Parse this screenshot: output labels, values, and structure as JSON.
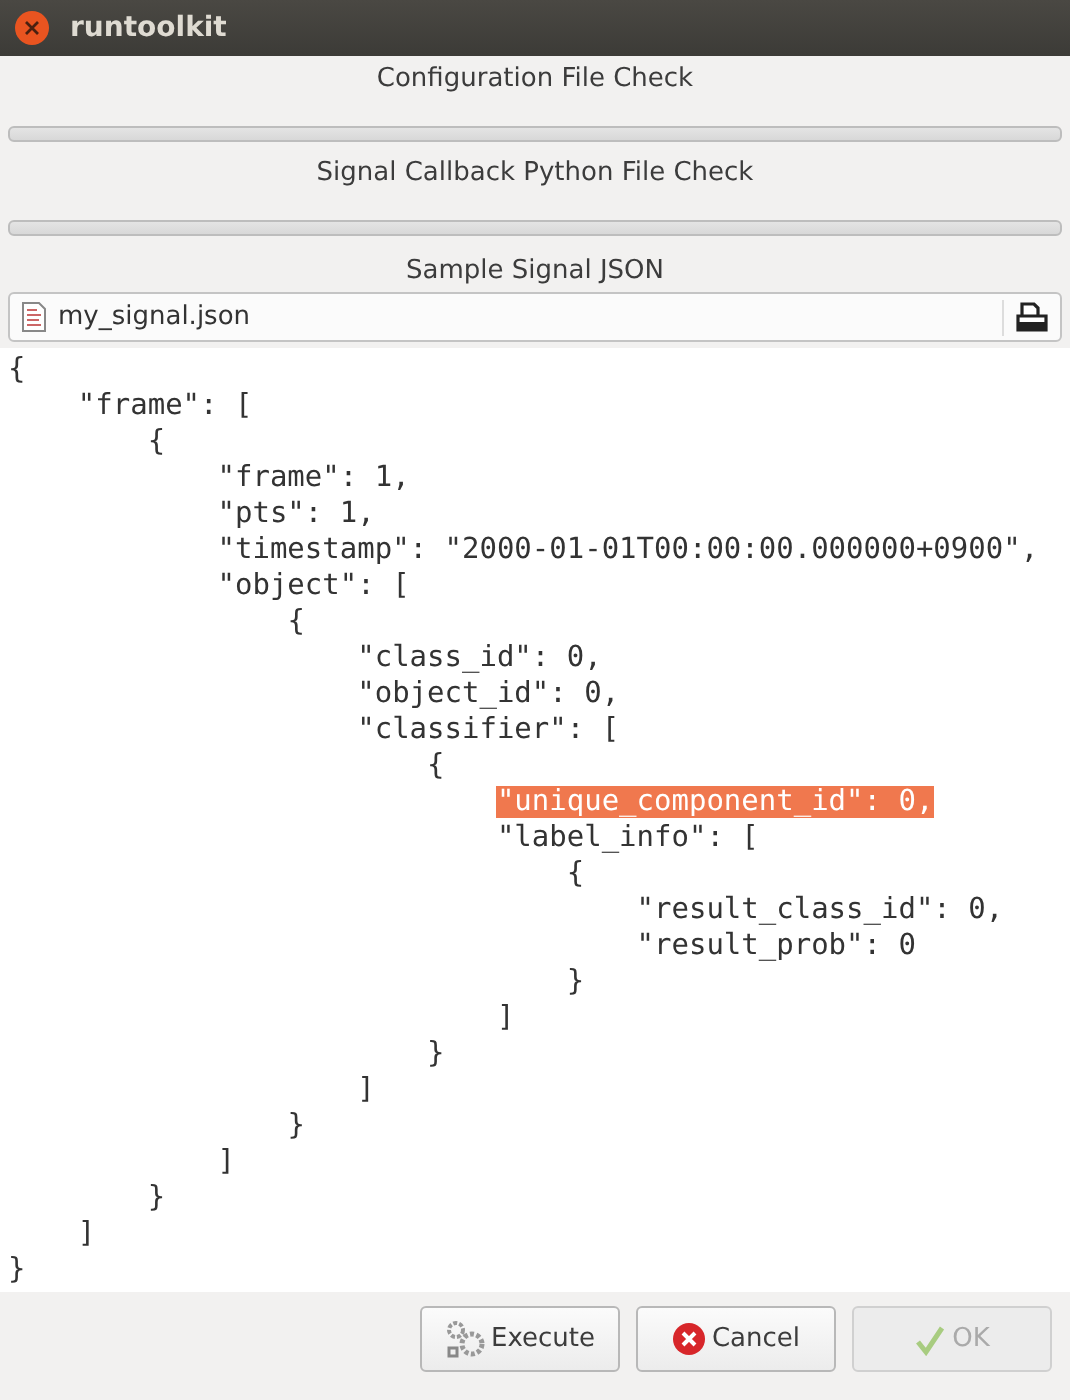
{
  "window": {
    "title": "runtoolkit"
  },
  "checks": [
    {
      "label": "Configuration File Check"
    },
    {
      "label": "Signal Callback Python File Check"
    }
  ],
  "sample": {
    "label": "Sample Signal JSON",
    "file": "my_signal.json"
  },
  "code_lines": [
    {
      "text": "{",
      "highlighted": false
    },
    {
      "text": "    \"frame\": [",
      "highlighted": false
    },
    {
      "text": "        {",
      "highlighted": false
    },
    {
      "text": "            \"frame\": 1,",
      "highlighted": false
    },
    {
      "text": "            \"pts\": 1,",
      "highlighted": false
    },
    {
      "text": "            \"timestamp\": \"2000-01-01T00:00:00.000000+0900\",",
      "highlighted": false
    },
    {
      "text": "            \"object\": [",
      "highlighted": false
    },
    {
      "text": "                {",
      "highlighted": false
    },
    {
      "text": "                    \"class_id\": 0,",
      "highlighted": false
    },
    {
      "text": "                    \"object_id\": 0,",
      "highlighted": false
    },
    {
      "text": "                    \"classifier\": [",
      "highlighted": false
    },
    {
      "text": "                        {",
      "highlighted": false
    },
    {
      "text": "                            \"unique_component_id\": 0,",
      "highlighted": true
    },
    {
      "text": "                            \"label_info\": [",
      "highlighted": false
    },
    {
      "text": "                                {",
      "highlighted": false
    },
    {
      "text": "                                    \"result_class_id\": 0,",
      "highlighted": false
    },
    {
      "text": "                                    \"result_prob\": 0",
      "highlighted": false
    },
    {
      "text": "                                }",
      "highlighted": false
    },
    {
      "text": "                            ]",
      "highlighted": false
    },
    {
      "text": "                        }",
      "highlighted": false
    },
    {
      "text": "                    ]",
      "highlighted": false
    },
    {
      "text": "                }",
      "highlighted": false
    },
    {
      "text": "            ]",
      "highlighted": false
    },
    {
      "text": "        }",
      "highlighted": false
    },
    {
      "text": "    ]",
      "highlighted": false
    },
    {
      "text": "}",
      "highlighted": false
    }
  ],
  "buttons": [
    {
      "kind": "execute",
      "label": "Execute",
      "disabled": false
    },
    {
      "kind": "cancel",
      "label": "Cancel",
      "disabled": false
    },
    {
      "kind": "ok",
      "label": "OK",
      "disabled": true
    }
  ]
}
